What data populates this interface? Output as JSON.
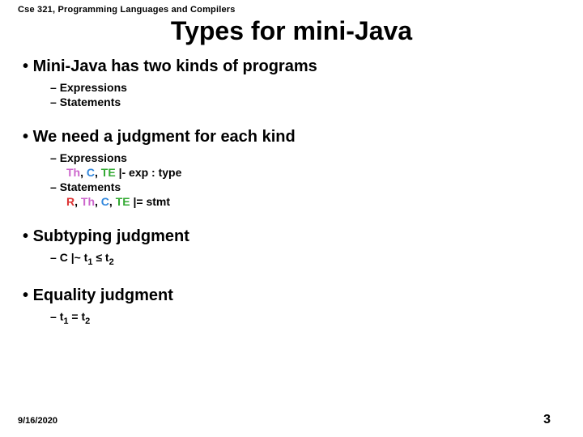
{
  "course_header": "Cse 321, Programming Languages and Compilers",
  "title": "Types for mini-Java",
  "b1": "Mini-Java has two kinds of programs",
  "b1s1": "Expressions",
  "b1s2": "Statements",
  "b2": "We need a judgment for each kind",
  "b2s1": "Expressions",
  "j_th": "Th",
  "j_c": "C",
  "j_te": "TE",
  "j_exp_tail": " |- exp : type",
  "b2s3": "Statements",
  "j_r": "R",
  "j_stmt_tail": " |=  stmt",
  "b3": "Subtyping judgment",
  "b3s1_pre": "C |~  t",
  "b3s1_sub1": "1",
  "b3s1_mid": " ≤ t",
  "b3s1_sub2": "2",
  "b4": "Equality judgment",
  "b4s1_pre": "t",
  "b4s1_sub1": "1",
  "b4s1_mid": " = t",
  "b4s1_sub2": "2",
  "footer_date": "9/16/2020",
  "footer_page": "3"
}
